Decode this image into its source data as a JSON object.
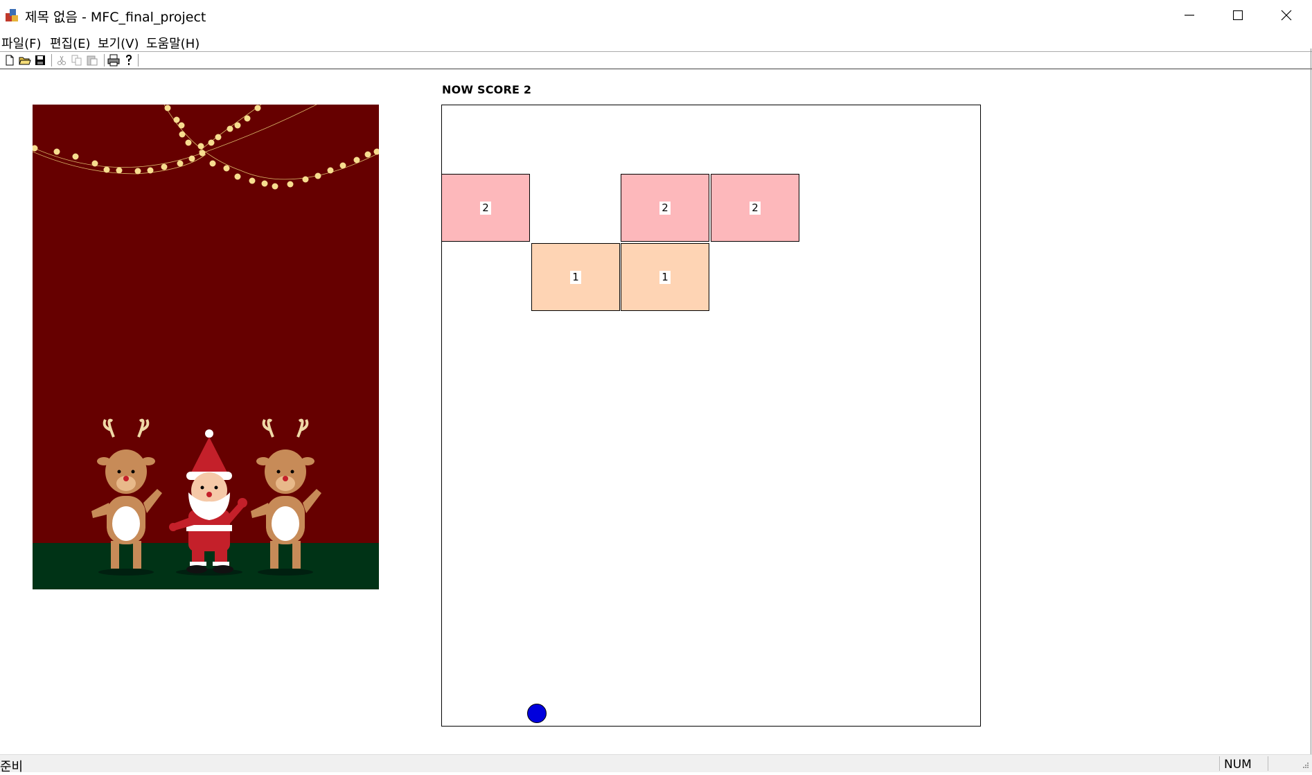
{
  "window": {
    "title": "제목 없음 - MFC_final_project",
    "app_icon": "mfc-app-icon",
    "controls": [
      "minimize-icon",
      "maximize-icon",
      "close-icon"
    ]
  },
  "menu": {
    "items": [
      {
        "label": "파일(F)"
      },
      {
        "label": "편집(E)"
      },
      {
        "label": "보기(V)"
      },
      {
        "label": "도움말(H)"
      }
    ]
  },
  "toolbar": {
    "buttons": [
      "new-file-icon",
      "open-folder-icon",
      "save-icon",
      "cut-icon",
      "copy-icon",
      "paste-icon",
      "print-icon",
      "help-icon"
    ]
  },
  "game": {
    "score_text": "NOW SCORE 2",
    "bricks": [
      {
        "label": "2",
        "level": 2
      },
      {
        "label": "2",
        "level": 2
      },
      {
        "label": "2",
        "level": 2
      },
      {
        "label": "1",
        "level": 1
      },
      {
        "label": "1",
        "level": 1
      }
    ],
    "ball_color": "#0000dd",
    "brick_colors": {
      "level2": "#fdb8bb",
      "level1": "#fed4b4"
    }
  },
  "picture": {
    "subject": "christmas-santa-reindeer-illustration",
    "background_color": "#660000",
    "ground_color": "#003316"
  },
  "status": {
    "text": "준비",
    "num": "NUM"
  }
}
